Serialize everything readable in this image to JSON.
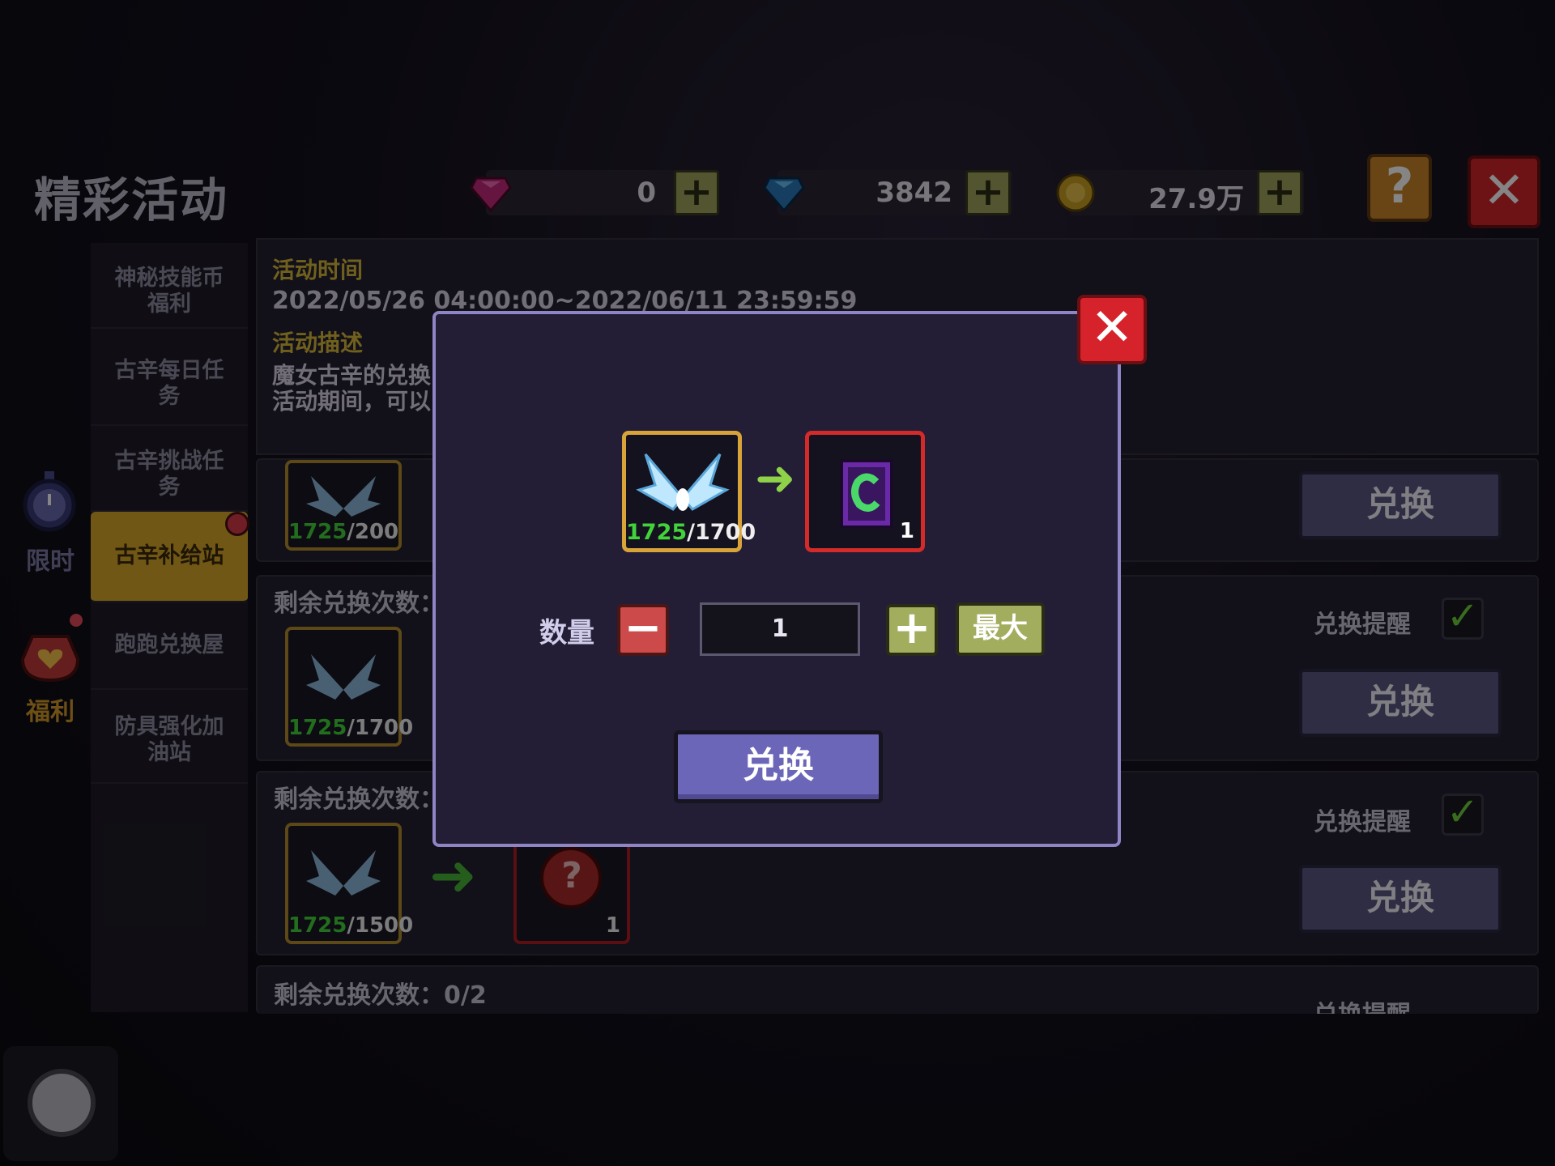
{
  "page_title": "精彩活动",
  "currencies": [
    {
      "name": "pink-gem",
      "value": "0",
      "color": "#c22a7a"
    },
    {
      "name": "blue-gem",
      "value": "3842",
      "color": "#2a78b8"
    },
    {
      "name": "gold-coin",
      "value": "27.9万",
      "color": "#c9a025"
    }
  ],
  "help_label": "?",
  "close_label": "✕",
  "side_icons": [
    {
      "label": "限时",
      "icon": "stopwatch-icon"
    },
    {
      "label": "福利",
      "icon": "heart-potion-icon"
    }
  ],
  "menu": [
    "神秘技能币\n福利",
    "古辛每日任\n务",
    "古辛挑战任\n务",
    "古辛补给站",
    "跑跑兑换屋",
    "防具强化加\n油站"
  ],
  "active_menu_index": 3,
  "info": {
    "time_label": "活动时间",
    "time_value": "2022/05/26 04:00:00~2022/06/11 23:59:59",
    "desc_label": "活动描述",
    "desc_line1": "魔女古辛的兑换",
    "desc_line2": "活动期间，可以"
  },
  "rows": [
    {
      "remain": "",
      "have": "1725",
      "need": "/200",
      "button": "兑换",
      "remind": ""
    },
    {
      "remain": "剩余兑换次数：",
      "have": "1725",
      "need": "/1700",
      "button": "兑换",
      "remind": "兑换提醒"
    },
    {
      "remain": "剩余兑换次数：",
      "have": "1725",
      "need": "/1500",
      "reward_count": "1",
      "reward_icon": "?",
      "button": "兑换",
      "remind": "兑换提醒"
    },
    {
      "remain": "剩余兑换次数：0/2",
      "remind": "兑换提醒"
    }
  ],
  "modal": {
    "close_label": "✕",
    "cost_have": "1725",
    "cost_need": "/1700",
    "reward_count": "1",
    "qty_label": "数量",
    "minus": "−",
    "qty_value": "1",
    "plus": "+",
    "max_label": "最大",
    "exchange_label": "兑换"
  }
}
